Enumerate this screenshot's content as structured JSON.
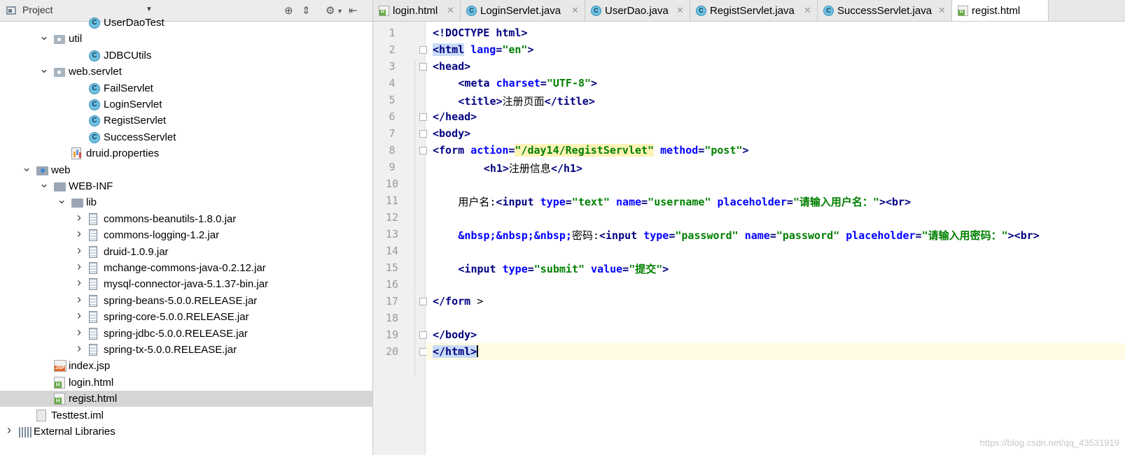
{
  "project_panel": {
    "title": "Project",
    "tree": [
      {
        "label": "UserDaoTest",
        "type": "class",
        "indent": 4,
        "arrow": ""
      },
      {
        "label": "util",
        "type": "package",
        "indent": 2,
        "arrow": "expanded"
      },
      {
        "label": "JDBCUtils",
        "type": "class",
        "indent": 4,
        "arrow": ""
      },
      {
        "label": "web.servlet",
        "type": "package",
        "indent": 2,
        "arrow": "expanded"
      },
      {
        "label": "FailServlet",
        "type": "class",
        "indent": 4,
        "arrow": ""
      },
      {
        "label": "LoginServlet",
        "type": "class",
        "indent": 4,
        "arrow": ""
      },
      {
        "label": "RegistServlet",
        "type": "class",
        "indent": 4,
        "arrow": ""
      },
      {
        "label": "SuccessServlet",
        "type": "class",
        "indent": 4,
        "arrow": ""
      },
      {
        "label": "druid.properties",
        "type": "properties",
        "indent": 3,
        "arrow": ""
      },
      {
        "label": "web",
        "type": "folder-web",
        "indent": 1,
        "arrow": "expanded"
      },
      {
        "label": "WEB-INF",
        "type": "folder",
        "indent": 2,
        "arrow": "expanded"
      },
      {
        "label": "lib",
        "type": "folder",
        "indent": 3,
        "arrow": "expanded"
      },
      {
        "label": "commons-beanutils-1.8.0.jar",
        "type": "jar",
        "indent": 4,
        "arrow": "collapsed"
      },
      {
        "label": "commons-logging-1.2.jar",
        "type": "jar",
        "indent": 4,
        "arrow": "collapsed"
      },
      {
        "label": "druid-1.0.9.jar",
        "type": "jar",
        "indent": 4,
        "arrow": "collapsed"
      },
      {
        "label": "mchange-commons-java-0.2.12.jar",
        "type": "jar",
        "indent": 4,
        "arrow": "collapsed"
      },
      {
        "label": "mysql-connector-java-5.1.37-bin.jar",
        "type": "jar",
        "indent": 4,
        "arrow": "collapsed"
      },
      {
        "label": "spring-beans-5.0.0.RELEASE.jar",
        "type": "jar",
        "indent": 4,
        "arrow": "collapsed"
      },
      {
        "label": "spring-core-5.0.0.RELEASE.jar",
        "type": "jar",
        "indent": 4,
        "arrow": "collapsed"
      },
      {
        "label": "spring-jdbc-5.0.0.RELEASE.jar",
        "type": "jar",
        "indent": 4,
        "arrow": "collapsed"
      },
      {
        "label": "spring-tx-5.0.0.RELEASE.jar",
        "type": "jar",
        "indent": 4,
        "arrow": "collapsed"
      },
      {
        "label": "index.jsp",
        "type": "jsp",
        "indent": 2,
        "arrow": ""
      },
      {
        "label": "login.html",
        "type": "html",
        "indent": 2,
        "arrow": ""
      },
      {
        "label": "regist.html",
        "type": "html",
        "indent": 2,
        "arrow": "",
        "selected": true
      },
      {
        "label": "Testtest.iml",
        "type": "iml",
        "indent": 1,
        "arrow": ""
      },
      {
        "label": "External Libraries",
        "type": "libs",
        "indent": 0,
        "arrow": "collapsed"
      }
    ]
  },
  "tabs": [
    {
      "label": "login.html",
      "type": "html",
      "active": false
    },
    {
      "label": "LoginServlet.java",
      "type": "class",
      "active": false
    },
    {
      "label": "UserDao.java",
      "type": "class",
      "active": false
    },
    {
      "label": "RegistServlet.java",
      "type": "class",
      "active": false
    },
    {
      "label": "SuccessServlet.java",
      "type": "class",
      "active": false
    },
    {
      "label": "regist.html",
      "type": "html",
      "active": true
    }
  ],
  "editor": {
    "current_line": 20,
    "lines": [
      {
        "n": "1",
        "indent": 0,
        "parts": [
          [
            "tag",
            "<!DOCTYPE "
          ],
          [
            "tag",
            "html"
          ],
          [
            "tag",
            ">"
          ]
        ]
      },
      {
        "n": "2",
        "indent": 0,
        "fold": true,
        "parts": [
          [
            "tag hl",
            "<html"
          ],
          [
            "tag",
            " "
          ],
          [
            "attr",
            "lang"
          ],
          [
            "tag",
            "="
          ],
          [
            "val",
            "\"en\""
          ],
          [
            "tag",
            ">"
          ]
        ]
      },
      {
        "n": "3",
        "indent": 0,
        "fold": true,
        "parts": [
          [
            "tag",
            "<head>"
          ]
        ]
      },
      {
        "n": "4",
        "indent": 4,
        "parts": [
          [
            "tag",
            "<meta "
          ],
          [
            "attr",
            "charset"
          ],
          [
            "tag",
            "="
          ],
          [
            "val",
            "\"UTF-8\""
          ],
          [
            "tag",
            ">"
          ]
        ]
      },
      {
        "n": "5",
        "indent": 4,
        "parts": [
          [
            "tag",
            "<title>"
          ],
          [
            "text",
            "注册页面"
          ],
          [
            "tag",
            "</title>"
          ]
        ]
      },
      {
        "n": "6",
        "indent": 0,
        "fold": true,
        "parts": [
          [
            "tag",
            "</head>"
          ]
        ]
      },
      {
        "n": "7",
        "indent": 0,
        "fold": true,
        "parts": [
          [
            "tag",
            "<body>"
          ]
        ]
      },
      {
        "n": "8",
        "indent": 0,
        "fold": true,
        "parts": [
          [
            "tag",
            "<form "
          ],
          [
            "attr",
            "action"
          ],
          [
            "tag",
            "="
          ],
          [
            "val hlpath",
            "\"/day14/RegistServlet\""
          ],
          [
            "tag",
            " "
          ],
          [
            "attr",
            "method"
          ],
          [
            "tag",
            "="
          ],
          [
            "val",
            "\"post\""
          ],
          [
            "tag",
            ">"
          ]
        ]
      },
      {
        "n": "9",
        "indent": 8,
        "parts": [
          [
            "tag",
            "<h1>"
          ],
          [
            "text",
            "注册信息"
          ],
          [
            "tag",
            "</h1>"
          ]
        ]
      },
      {
        "n": "10",
        "indent": 0,
        "parts": []
      },
      {
        "n": "11",
        "indent": 4,
        "parts": [
          [
            "text",
            "用户名:"
          ],
          [
            "tag",
            "<input "
          ],
          [
            "attr",
            "type"
          ],
          [
            "tag",
            "="
          ],
          [
            "val",
            "\"text\""
          ],
          [
            "tag",
            " "
          ],
          [
            "attr",
            "name"
          ],
          [
            "tag",
            "="
          ],
          [
            "val",
            "\"username\""
          ],
          [
            "tag",
            " "
          ],
          [
            "attr",
            "placeholder"
          ],
          [
            "tag",
            "="
          ],
          [
            "val",
            "\"请输入用户名：\""
          ],
          [
            "tag",
            ">"
          ],
          [
            "tag",
            "<br>"
          ]
        ]
      },
      {
        "n": "12",
        "indent": 0,
        "parts": []
      },
      {
        "n": "13",
        "indent": 4,
        "parts": [
          [
            "attr",
            "&nbsp;&nbsp;&nbsp;"
          ],
          [
            "text",
            "密码:"
          ],
          [
            "tag",
            "<input "
          ],
          [
            "attr",
            "type"
          ],
          [
            "tag",
            "="
          ],
          [
            "val",
            "\"password\""
          ],
          [
            "tag",
            " "
          ],
          [
            "attr",
            "name"
          ],
          [
            "tag",
            "="
          ],
          [
            "val",
            "\"password\""
          ],
          [
            "tag",
            " "
          ],
          [
            "attr",
            "placeholder"
          ],
          [
            "tag",
            "="
          ],
          [
            "val",
            "\"请输入用密码：\""
          ],
          [
            "tag",
            ">"
          ],
          [
            "tag",
            "<br>"
          ]
        ]
      },
      {
        "n": "14",
        "indent": 0,
        "parts": []
      },
      {
        "n": "15",
        "indent": 4,
        "parts": [
          [
            "tag",
            "<input "
          ],
          [
            "attr",
            "type"
          ],
          [
            "tag",
            "="
          ],
          [
            "val",
            "\"submit\""
          ],
          [
            "tag",
            " "
          ],
          [
            "attr",
            "value"
          ],
          [
            "tag",
            "="
          ],
          [
            "val",
            "\"提交\""
          ],
          [
            "tag",
            ">"
          ]
        ]
      },
      {
        "n": "16",
        "indent": 0,
        "parts": []
      },
      {
        "n": "17",
        "indent": 0,
        "fold": true,
        "parts": [
          [
            "tag",
            "</form "
          ],
          [
            "text",
            ">"
          ]
        ]
      },
      {
        "n": "18",
        "indent": 0,
        "parts": []
      },
      {
        "n": "19",
        "indent": 0,
        "fold": true,
        "parts": [
          [
            "tag",
            "</body>"
          ]
        ]
      },
      {
        "n": "20",
        "indent": 0,
        "fold": true,
        "cursor": true,
        "parts": [
          [
            "tag hl",
            "</html>"
          ]
        ]
      }
    ]
  },
  "watermark": "https://blog.csdn.net/qq_43531919",
  "colors": {
    "tag": "#000080",
    "attr": "#0000ff",
    "value": "#008000",
    "selection": "#d5d5d5",
    "current_line": "#fffae3"
  }
}
